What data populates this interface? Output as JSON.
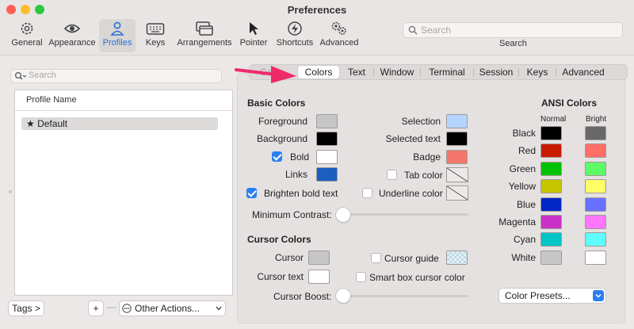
{
  "window": {
    "title": "Preferences"
  },
  "toolbar": {
    "items": [
      {
        "label": "General",
        "icon": "gear-icon"
      },
      {
        "label": "Appearance",
        "icon": "eye-icon"
      },
      {
        "label": "Profiles",
        "icon": "person-icon"
      },
      {
        "label": "Keys",
        "icon": "keyboard-icon"
      },
      {
        "label": "Arrangements",
        "icon": "windows-icon"
      },
      {
        "label": "Pointer",
        "icon": "pointer-icon"
      },
      {
        "label": "Shortcuts",
        "icon": "lightning-icon"
      },
      {
        "label": "Advanced",
        "icon": "gears-icon"
      }
    ],
    "active": "Profiles",
    "search_placeholder": "Search",
    "search_label": "Search"
  },
  "profiles": {
    "search_placeholder": "Search",
    "column_header": "Profile Name",
    "rows": [
      {
        "name": "★ Default"
      }
    ],
    "tags_button": "Tags >",
    "add_button": "+",
    "remove_button": "—",
    "other_actions": "Other Actions..."
  },
  "tabs": {
    "items": [
      "General",
      "Colors",
      "Text",
      "Window",
      "Terminal",
      "Session",
      "Keys",
      "Advanced"
    ],
    "visible_first": "Ge",
    "selected": "Colors"
  },
  "basic_colors": {
    "header": "Basic Colors",
    "foreground_label": "Foreground",
    "foreground_color": "#c6c6c6",
    "background_label": "Background",
    "background_color": "#000000",
    "bold_label": "Bold",
    "bold_checked": true,
    "bold_color": "#ffffff",
    "links_label": "Links",
    "links_color": "#1a5fbf",
    "brighten_label": "Brighten bold text",
    "brighten_checked": true,
    "selection_label": "Selection",
    "selection_color": "#b5d5ff",
    "selected_text_label": "Selected text",
    "selected_text_color": "#000000",
    "badge_label": "Badge",
    "badge_color": "#f3786b",
    "tab_color_label": "Tab color",
    "tab_color_checked": false,
    "underline_color_label": "Underline color",
    "underline_color_checked": false,
    "min_contrast_label": "Minimum Contrast:",
    "min_contrast_value": 0
  },
  "cursor_colors": {
    "header": "Cursor Colors",
    "cursor_label": "Cursor",
    "cursor_color": "#c6c6c6",
    "cursor_text_label": "Cursor text",
    "cursor_text_color": "#ffffff",
    "cursor_guide_label": "Cursor guide",
    "cursor_guide_checked": false,
    "smart_box_label": "Smart box cursor color",
    "smart_box_checked": false,
    "boost_label": "Cursor Boost:",
    "boost_value": 0
  },
  "ansi": {
    "header": "ANSI Colors",
    "normal_label": "Normal",
    "bright_label": "Bright",
    "rows": [
      {
        "name": "Black",
        "normal": "#000000",
        "bright": "#686868"
      },
      {
        "name": "Red",
        "normal": "#c91b00",
        "bright": "#ff6e67"
      },
      {
        "name": "Green",
        "normal": "#00c200",
        "bright": "#5ffa68"
      },
      {
        "name": "Yellow",
        "normal": "#c7c400",
        "bright": "#fffc67"
      },
      {
        "name": "Blue",
        "normal": "#0225c7",
        "bright": "#6871ff"
      },
      {
        "name": "Magenta",
        "normal": "#c930c7",
        "bright": "#ff77ff"
      },
      {
        "name": "Cyan",
        "normal": "#00c5c7",
        "bright": "#60fdff"
      },
      {
        "name": "White",
        "normal": "#c7c7c7",
        "bright": "#ffffff"
      }
    ],
    "presets_label": "Color Presets..."
  },
  "colors": {
    "accent": "#2a7ff0",
    "annotation_arrow": "#ee2a6b"
  }
}
